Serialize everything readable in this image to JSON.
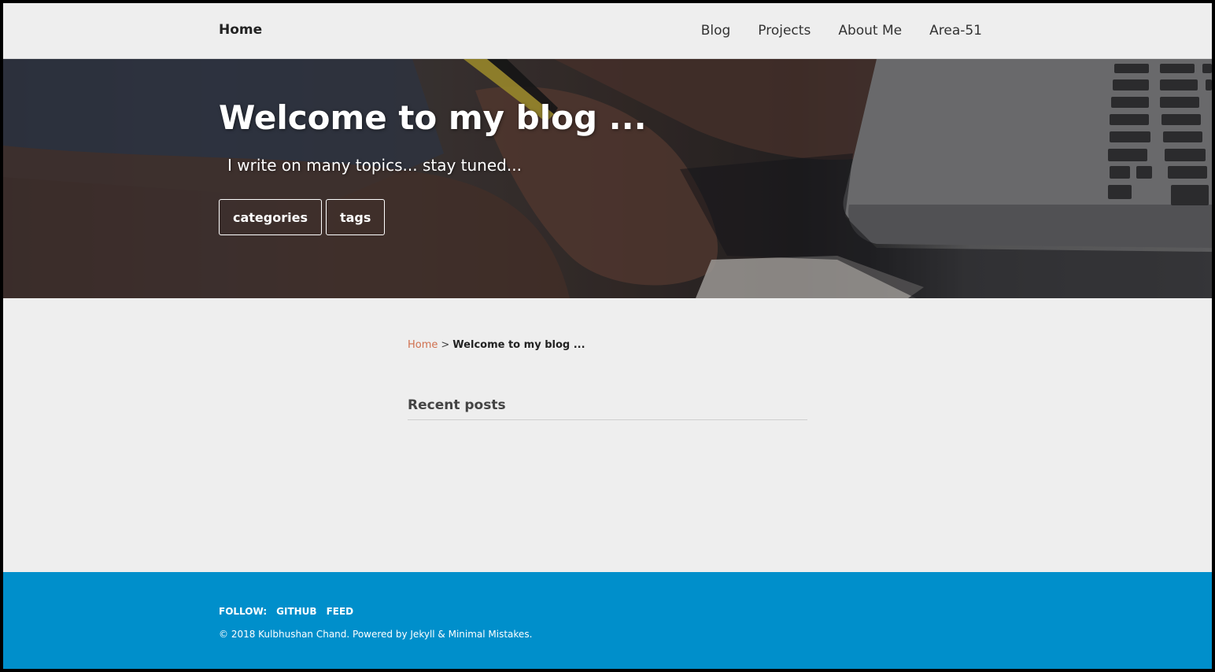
{
  "masthead": {
    "site_title": "Home",
    "nav": [
      "Blog",
      "Projects",
      "About Me",
      "Area-51"
    ]
  },
  "hero": {
    "title": "Welcome to my blog ...",
    "subtitle": "I write on many topics... stay tuned...",
    "buttons": [
      "categories",
      "tags"
    ]
  },
  "breadcrumbs": {
    "home": "Home",
    "separator": ">",
    "current": "Welcome to my blog ..."
  },
  "main": {
    "section_title": "Recent posts"
  },
  "footer": {
    "follow_label": "FOLLOW:",
    "links": [
      "GITHUB",
      "FEED"
    ],
    "copyright": "© 2018 Kulbhushan Chand. Powered by Jekyll & Minimal Mistakes."
  },
  "colors": {
    "page_bg": "#eeeeee",
    "footer_bg": "#008fcb",
    "breadcrumb_link": "#d0704f"
  }
}
